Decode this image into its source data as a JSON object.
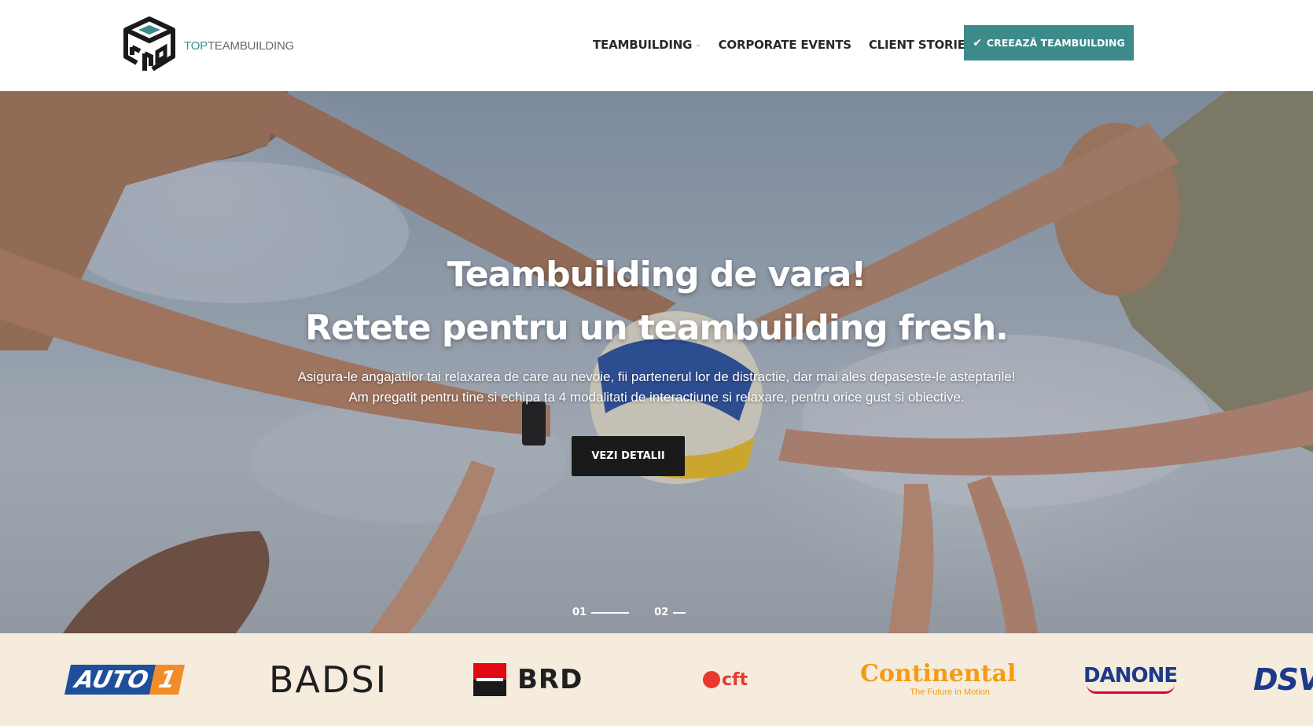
{
  "header": {
    "logo": {
      "text_accent": "TOP",
      "text_main": "TEAMBUILDING",
      "icon": "cube-logo-icon"
    },
    "nav": [
      {
        "label": "TEAMBUILDING",
        "has_dropdown": true
      },
      {
        "label": "CORPORATE EVENTS"
      },
      {
        "label": "CLIENT STORIES"
      }
    ],
    "cta": {
      "label": "CREEAZĂ TEAMBUILDING",
      "icon": "check-icon"
    }
  },
  "hero": {
    "title_line1": "Teambuilding de vara!",
    "title_line2": "Retete pentru un teambuilding fresh.",
    "desc_line1": "Asigura-le angajatilor tai relaxarea de care au nevoie, fii partenerul lor de distractie, dar mai ales depaseste-le asteptarile!",
    "desc_line2": "Am pregatit pentru tine si echipa ta 4 modalitati de interactiune si relaxare, pentru orice gust si obiective.",
    "button_label": "VEZI DETALII",
    "pager": [
      "01",
      "02"
    ]
  },
  "clients": {
    "auto1": {
      "word": "AUTO",
      "num": "1"
    },
    "badsi": "BADSI",
    "brd": "BRD",
    "cft": "cft",
    "continental": {
      "name": "Continental",
      "tagline": "The Future in Motion"
    },
    "danone": "DANONE",
    "dsv": "DSV"
  },
  "colors": {
    "accent": "#3d8a8a",
    "hero_button": "#1a1a1a",
    "clients_bg": "#f5ecde"
  }
}
